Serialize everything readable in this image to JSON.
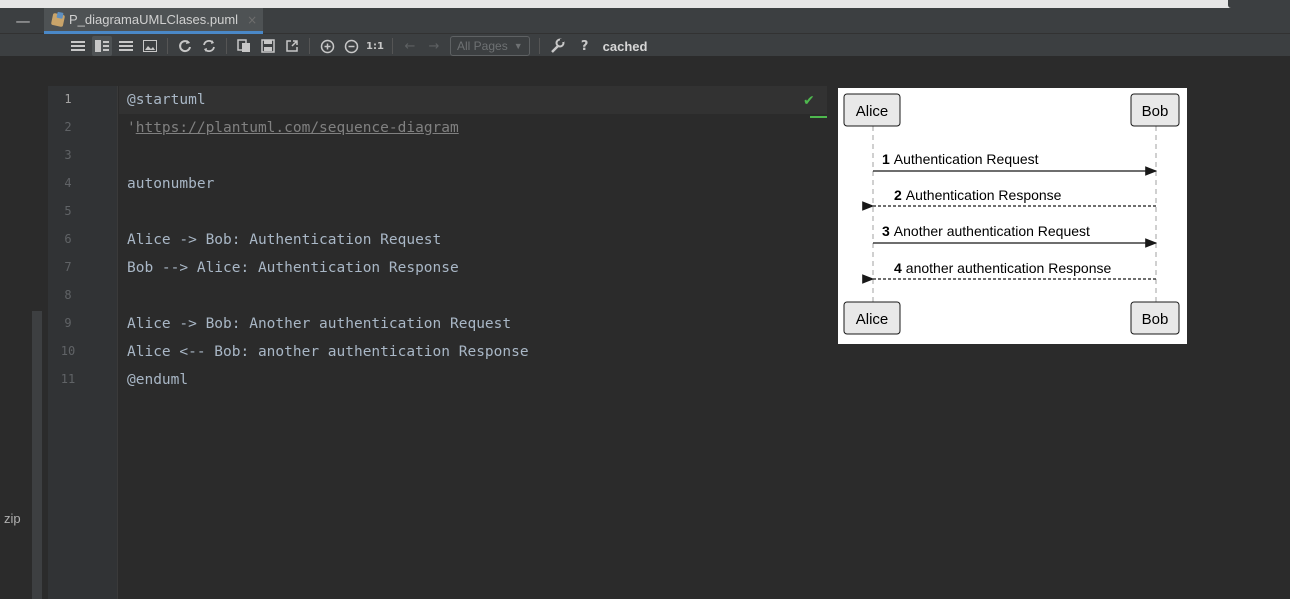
{
  "tab": {
    "filename": "P_diagramaUMLClases.puml",
    "close_glyph": "×",
    "collapse_glyph": "—"
  },
  "toolbar": {
    "zoom_actual": "1:1",
    "pages_label": "All Pages",
    "help": "?",
    "status": "cached"
  },
  "sidebar": {
    "label": "zip"
  },
  "editor": {
    "line_numbers": [
      "1",
      "2",
      "3",
      "4",
      "5",
      "6",
      "7",
      "8",
      "9",
      "10",
      "11"
    ],
    "lines": {
      "l1": "@startuml",
      "l2_quote": "'",
      "l2_url": "https://plantuml.com/sequence-diagram",
      "l4": "autonumber",
      "l6": "Alice -> Bob: Authentication Request",
      "l7": "Bob --> Alice: Authentication Response",
      "l9": "Alice -> Bob: Another authentication Request",
      "l10": "Alice <-- Bob: another authentication Response",
      "l11": "@enduml"
    }
  },
  "diagram": {
    "participants": {
      "left": "Alice",
      "right": "Bob"
    },
    "messages": [
      {
        "num": "1",
        "text": "Authentication Request",
        "dir": "right",
        "style": "solid"
      },
      {
        "num": "2",
        "text": "Authentication Response",
        "dir": "left",
        "style": "dashed"
      },
      {
        "num": "3",
        "text": "Another authentication Request",
        "dir": "right",
        "style": "solid"
      },
      {
        "num": "4",
        "text": "another authentication Response",
        "dir": "left",
        "style": "dashed"
      }
    ]
  },
  "colors": {
    "annotation": "#bbb529",
    "keyword": "#cc7832",
    "comment": "#808080",
    "ok": "#4eb84e"
  }
}
